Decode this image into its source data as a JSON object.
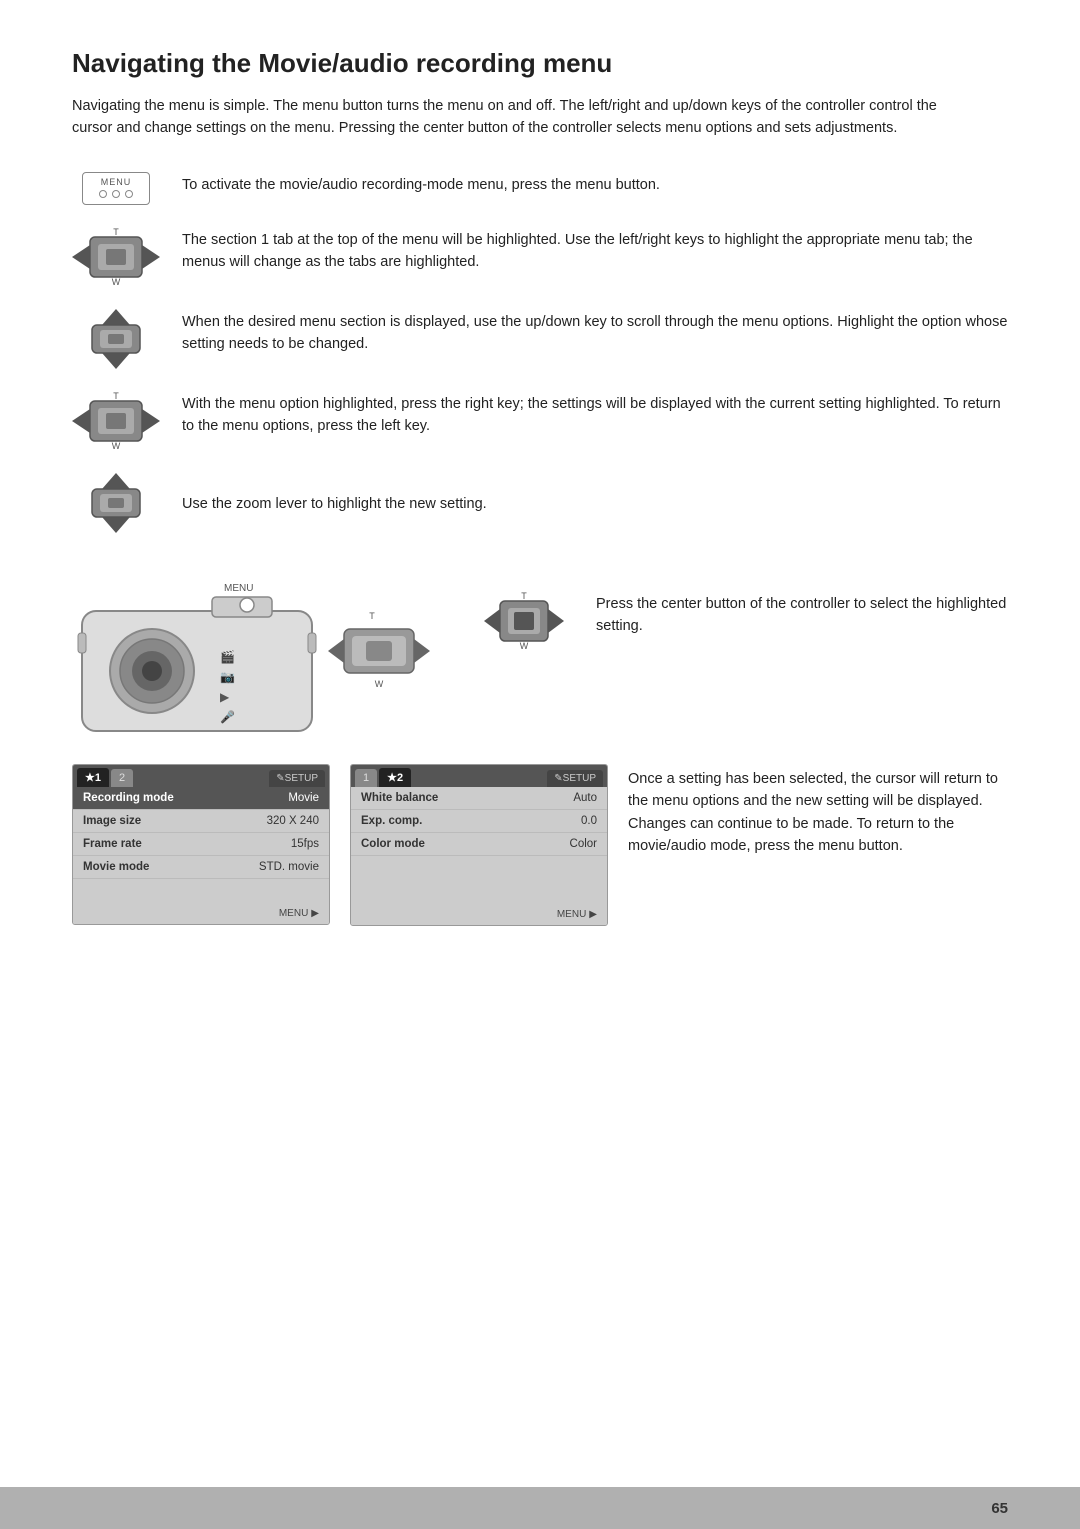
{
  "page": {
    "title": "Navigating the Movie/audio recording menu",
    "intro": "Navigating the menu is simple. The menu button turns the menu on and off. The left/right and up/down keys of the controller control the cursor and change settings on the menu. Pressing the center button of the controller selects menu options and sets adjustments.",
    "page_number": "65"
  },
  "instructions": [
    {
      "icon": "menu-button",
      "text": "To activate the movie/audio recording-mode menu, press the menu button."
    },
    {
      "icon": "controller-lr",
      "text": "The section 1 tab at the top of the menu will be highlighted. Use the left/right keys to highlight the appropriate menu tab; the menus will change as the tabs are highlighted."
    },
    {
      "icon": "controller-ud",
      "text": "When the desired menu section is displayed, use the up/down key to scroll through the menu options. Highlight the option whose setting needs to be changed."
    },
    {
      "icon": "controller-lr",
      "text": "With the menu option highlighted, press the right key; the settings will be displayed with the current setting highlighted. To return to the menu options, press the left key."
    }
  ],
  "zoom_instruction": {
    "icon": "controller-ud",
    "text": "Use the zoom lever to highlight the new setting."
  },
  "center_button_instruction": {
    "text": "Press the center button of the controller to select the highlighted setting."
  },
  "menu_instruction": {
    "text": "Once a setting has been selected, the cursor will return to the menu options and the new setting will be displayed. Changes can continue to be made. To return to the movie/audio mode, press the menu button."
  },
  "menu1": {
    "tabs": [
      {
        "label": "★1",
        "active": true
      },
      {
        "label": "2",
        "active": false
      },
      {
        "label": "✎SETUP",
        "active": false
      }
    ],
    "rows": [
      {
        "key": "Recording mode",
        "value": "Movie",
        "highlighted": true
      },
      {
        "key": "Image size",
        "value": "320 X 240",
        "highlighted": false
      },
      {
        "key": "Frame rate",
        "value": "15fps",
        "highlighted": false
      },
      {
        "key": "Movie mode",
        "value": "STD. movie",
        "highlighted": false
      }
    ],
    "footer": "MENU"
  },
  "menu2": {
    "tabs": [
      {
        "label": "1",
        "active": false
      },
      {
        "label": "★2",
        "active": true
      },
      {
        "label": "✎SETUP",
        "active": false
      }
    ],
    "rows": [
      {
        "key": "White balance",
        "value": "Auto",
        "highlighted": false
      },
      {
        "key": "Exp. comp.",
        "value": "0.0",
        "highlighted": false
      },
      {
        "key": "Color mode",
        "value": "Color",
        "highlighted": false
      }
    ],
    "footer": "MENU"
  }
}
